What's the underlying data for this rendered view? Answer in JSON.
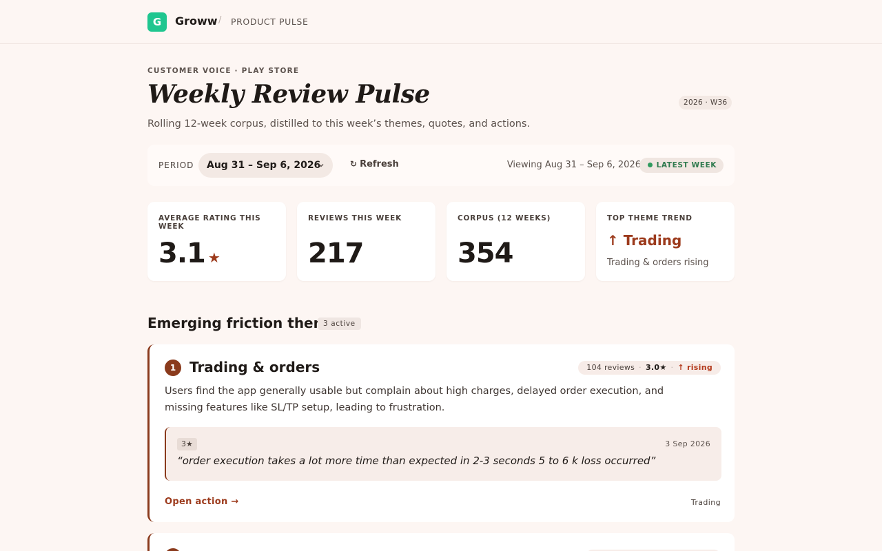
{
  "header": {
    "logo_letter": "G",
    "brand": "Groww",
    "separator": "/",
    "crumb": "PRODUCT PULSE"
  },
  "hero": {
    "eyebrow": "CUSTOMER VOICE · PLAY STORE",
    "title": "Weekly Review Pulse",
    "week_badge": "2026 · W36",
    "subtitle": "Rolling 12-week corpus, distilled to this week’s themes, quotes, and actions."
  },
  "period": {
    "label": "PERIOD",
    "selected": "Aug 31 – Sep 6, 2026",
    "refresh_icon": "refresh-icon",
    "refresh_label": "Refresh",
    "viewing": "Viewing Aug 31 – Sep 6, 2026",
    "latest_badge": "LATEST WEEK"
  },
  "stats": {
    "avg_rating": {
      "label": "AVERAGE RATING THIS WEEK",
      "value": "3.1",
      "star": "★"
    },
    "reviews": {
      "label": "REVIEWS THIS WEEK",
      "value": "217"
    },
    "corpus": {
      "label": "CORPUS (12 WEEKS)",
      "value": "354"
    },
    "trend": {
      "label": "TOP THEME TREND",
      "arrow": "↑",
      "value": "Trading",
      "sub": "Trading & orders rising"
    }
  },
  "themes_section": {
    "title": "Emerging friction themes",
    "badge": "3 active",
    "items": [
      {
        "number": "1",
        "title": "Trading & orders",
        "reviews": "104 reviews",
        "rating": "3.0★",
        "trend": "↑ rising",
        "description": "Users find the app generally usable but complain about high charges, delayed order execution, and missing features like SL/TP setup, leading to frustration.",
        "quote_rating": "3★",
        "quote_date": "3 Sep 2026",
        "quote": "“order execution takes a lot more time than expected in 2-3 seconds 5 to 6 k loss occurred”",
        "action": "Open action →",
        "tag": "Trading"
      }
    ]
  },
  "colors": {
    "background": "#fdf6f3",
    "accent": "#9c3a1c",
    "brand_green": "#1fc68f",
    "status_green": "#2f7a4e"
  }
}
